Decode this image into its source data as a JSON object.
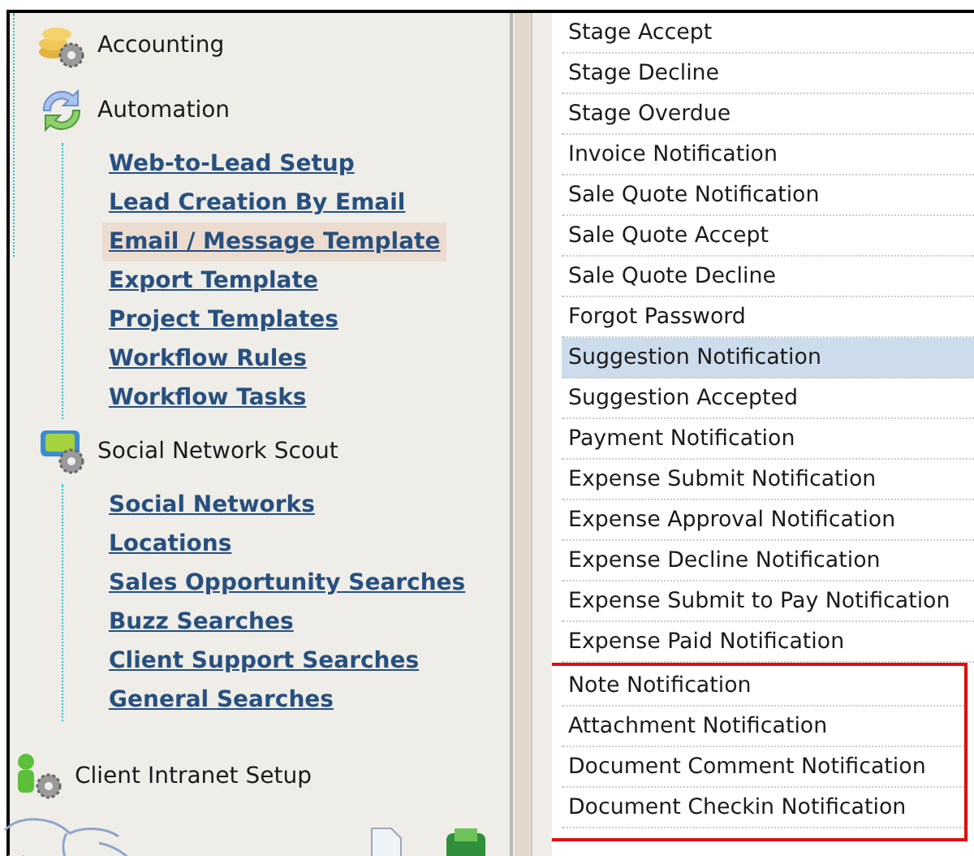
{
  "sidebar": {
    "groups": [
      {
        "kind": "accounting",
        "label": "Accounting"
      },
      {
        "kind": "automation",
        "label": "Automation",
        "children": [
          {
            "label": "Web-to-Lead Setup",
            "selected": false
          },
          {
            "label": "Lead Creation By Email",
            "selected": false
          },
          {
            "label": "Email / Message Template",
            "selected": true
          },
          {
            "label": "Export Template",
            "selected": false
          },
          {
            "label": "Project Templates",
            "selected": false
          },
          {
            "label": "Workflow Rules",
            "selected": false
          },
          {
            "label": "Workflow Tasks",
            "selected": false
          }
        ]
      },
      {
        "kind": "social",
        "label": "Social Network Scout",
        "children": [
          {
            "label": "Social Networks",
            "selected": false
          },
          {
            "label": "Locations",
            "selected": false
          },
          {
            "label": "Sales Opportunity Searches",
            "selected": false
          },
          {
            "label": "Buzz Searches",
            "selected": false
          },
          {
            "label": "Client Support Searches",
            "selected": false
          },
          {
            "label": "General Searches",
            "selected": false
          }
        ]
      },
      {
        "kind": "intranet",
        "label": "Client Intranet Setup"
      }
    ]
  },
  "templates": [
    {
      "label": "Stage Accept",
      "selected": false,
      "outlined": false
    },
    {
      "label": "Stage Decline",
      "selected": false,
      "outlined": false
    },
    {
      "label": "Stage Overdue",
      "selected": false,
      "outlined": false
    },
    {
      "label": "Invoice Notification",
      "selected": false,
      "outlined": false
    },
    {
      "label": "Sale Quote Notification",
      "selected": false,
      "outlined": false
    },
    {
      "label": "Sale Quote Accept",
      "selected": false,
      "outlined": false
    },
    {
      "label": "Sale Quote Decline",
      "selected": false,
      "outlined": false
    },
    {
      "label": "Forgot Password",
      "selected": false,
      "outlined": false
    },
    {
      "label": "Suggestion Notification",
      "selected": true,
      "outlined": false
    },
    {
      "label": "Suggestion Accepted",
      "selected": false,
      "outlined": false
    },
    {
      "label": "Payment Notification",
      "selected": false,
      "outlined": false
    },
    {
      "label": "Expense Submit Notification",
      "selected": false,
      "outlined": false
    },
    {
      "label": "Expense Approval Notification",
      "selected": false,
      "outlined": false
    },
    {
      "label": "Expense Decline Notification",
      "selected": false,
      "outlined": false
    },
    {
      "label": "Expense Submit to Pay Notification",
      "selected": false,
      "outlined": false
    },
    {
      "label": "Expense Paid Notification",
      "selected": false,
      "outlined": false
    },
    {
      "label": "Note Notification",
      "selected": false,
      "outlined": true
    },
    {
      "label": "Attachment Notification",
      "selected": false,
      "outlined": true
    },
    {
      "label": "Document Comment Notification",
      "selected": false,
      "outlined": true
    },
    {
      "label": "Document Checkin Notification",
      "selected": false,
      "outlined": true
    }
  ]
}
